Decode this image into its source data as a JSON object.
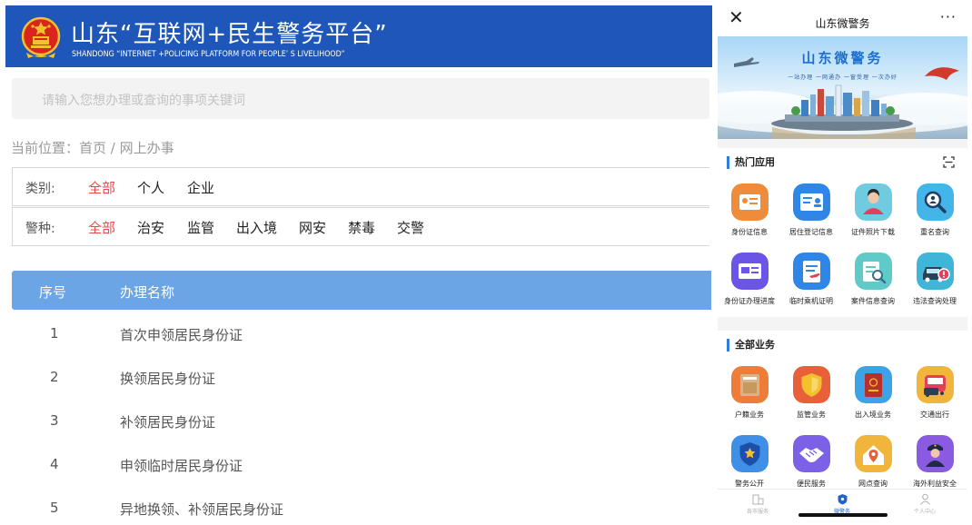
{
  "web": {
    "banner": {
      "title": "山东“互联网+民生警务平台”",
      "subtitle": "SHANDONG “INTERNET +POLICING PLATFORM FOR PEOPLE’ S LIVELIHOOD”",
      "bg_color": "#1e57b9"
    },
    "search": {
      "placeholder": "请输入您想办理或查询的事项关键词"
    },
    "breadcrumb": "当前位置：首页 / 网上办事",
    "filters": [
      {
        "label": "类别:",
        "options": [
          "全部",
          "个人",
          "企业"
        ],
        "active_index": 0
      },
      {
        "label": "警种:",
        "options": [
          "全部",
          "治安",
          "监管",
          "出入境",
          "网安",
          "禁毒",
          "交警"
        ],
        "active_index": 0
      }
    ],
    "table": {
      "headers": {
        "no": "序号",
        "name": "办理名称"
      },
      "rows": [
        {
          "no": "1",
          "name": "首次申领居民身份证"
        },
        {
          "no": "2",
          "name": "换领居民身份证"
        },
        {
          "no": "3",
          "name": "补领居民身份证"
        },
        {
          "no": "4",
          "name": "申领临时居民身份证"
        },
        {
          "no": "5",
          "name": "异地换领、补领居民身份证"
        }
      ]
    },
    "accent_color": "#e84a4a",
    "header_color": "#6ba5e6"
  },
  "phone": {
    "nav": {
      "close": "✕",
      "title": "山东微警务",
      "more": "···"
    },
    "hero": {
      "title": "山东微警务",
      "slogan": "一站办理 一网通办 一窗受理 一次办好"
    },
    "hot": {
      "title": "热门应用",
      "apps": [
        {
          "label": "身份证信息",
          "icon": "id-card-icon",
          "color": "#ef8c3c"
        },
        {
          "label": "居住登记信息",
          "icon": "residence-card-icon",
          "color": "#2f86e6"
        },
        {
          "label": "证件照片下载",
          "icon": "photo-person-icon",
          "color": "#6fcbe0"
        },
        {
          "label": "重名查询",
          "icon": "magnifier-icon",
          "color": "#44b5e8"
        },
        {
          "label": "身份证办理进度",
          "icon": "id-progress-icon",
          "color": "#6b55e6"
        },
        {
          "label": "临时乘机证明",
          "icon": "flight-doc-icon",
          "color": "#2f86e6"
        },
        {
          "label": "案件信息查询",
          "icon": "case-search-icon",
          "color": "#5fcac8"
        },
        {
          "label": "违法查询处理",
          "icon": "car-violation-icon",
          "color": "#3fb5d8"
        }
      ]
    },
    "all": {
      "title": "全部业务",
      "apps": [
        {
          "label": "户籍业务",
          "icon": "household-book-icon",
          "color": "#ef7d3a"
        },
        {
          "label": "监管业务",
          "icon": "shield-icon",
          "color": "#e8603a"
        },
        {
          "label": "出入境业务",
          "icon": "passport-icon",
          "color": "#3ea3e6"
        },
        {
          "label": "交通出行",
          "icon": "bus-icon",
          "color": "#f0b53a"
        },
        {
          "label": "警务公开",
          "icon": "police-badge-icon",
          "color": "#3f8fe6"
        },
        {
          "label": "便民服务",
          "icon": "handshake-icon",
          "color": "#7c61e6"
        },
        {
          "label": "网点查询",
          "icon": "location-house-icon",
          "color": "#f0b53a"
        },
        {
          "label": "海外利益安全",
          "icon": "officer-icon",
          "color": "#8a5be0"
        }
      ]
    },
    "tabs": [
      {
        "label": "各市服务",
        "icon": "city-buildings-icon"
      },
      {
        "label": "微警务",
        "icon": "police-shield-icon",
        "active": true
      },
      {
        "label": "个人中心",
        "icon": "person-icon"
      }
    ]
  }
}
